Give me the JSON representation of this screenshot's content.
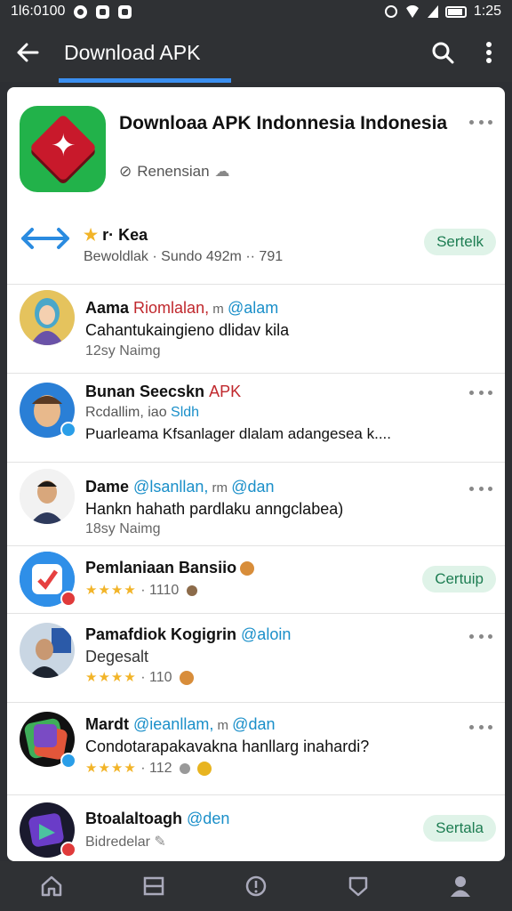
{
  "status_bar": {
    "time_left": "1l6:0100",
    "time_right": "1:25"
  },
  "app_bar": {
    "title": "Download APK"
  },
  "header": {
    "title": "Downloaa APK  Indonnesia Indonesia",
    "subtitle": "Renensian"
  },
  "featured": {
    "title": "r· Kea",
    "meta": "Bewoldlak · Sundo  492m ··  791",
    "action": "Sertelk"
  },
  "rows": [
    {
      "name": "Aama",
      "name_hl": "Riomlalan,",
      "name_mid": " m ",
      "tag": "@alam",
      "line": "Cahantukaingieno  dlidav kila",
      "meta": "12sy Naimg"
    },
    {
      "name": "Bunan Seecskn",
      "name_hl": "APK",
      "sub_a": "Rcdallim, ",
      "sub_mid": "iao ",
      "sub_tag": "Sldh",
      "line": "Puarleama Kfsanlager dlalam adangesea k...."
    },
    {
      "name": "Dame",
      "name_hl": "@lsanllan,",
      "name_mid": " rm ",
      "tag": "@dan",
      "line": "Hankn hahath pardlaku anngclabea)",
      "meta": "18sy Naimg"
    },
    {
      "name": "Pemlaniaan Bansiio",
      "rating_text": "· 1110",
      "action": "Certuip"
    },
    {
      "name": "Pamafdiok Kogigrin",
      "tag": "@aloin",
      "line": "Degesalt",
      "rating_text": "· 110"
    },
    {
      "name": "Mardt",
      "name_hl": "@ieanllam,",
      "name_mid": " m ",
      "tag": "@dan",
      "line": "Condotarapakavakna hanllarg inahardi?",
      "rating_text": "· 112"
    },
    {
      "name": "Btoalaltoagh",
      "tag": "@den",
      "line": "Bidredelar",
      "action": "Sertala"
    }
  ],
  "colors": {
    "accent": "#3b8ff0",
    "bar": "#2f3134",
    "pill_bg": "#dff3e8",
    "pill_text": "#1d7d52",
    "star": "#f2b428"
  }
}
